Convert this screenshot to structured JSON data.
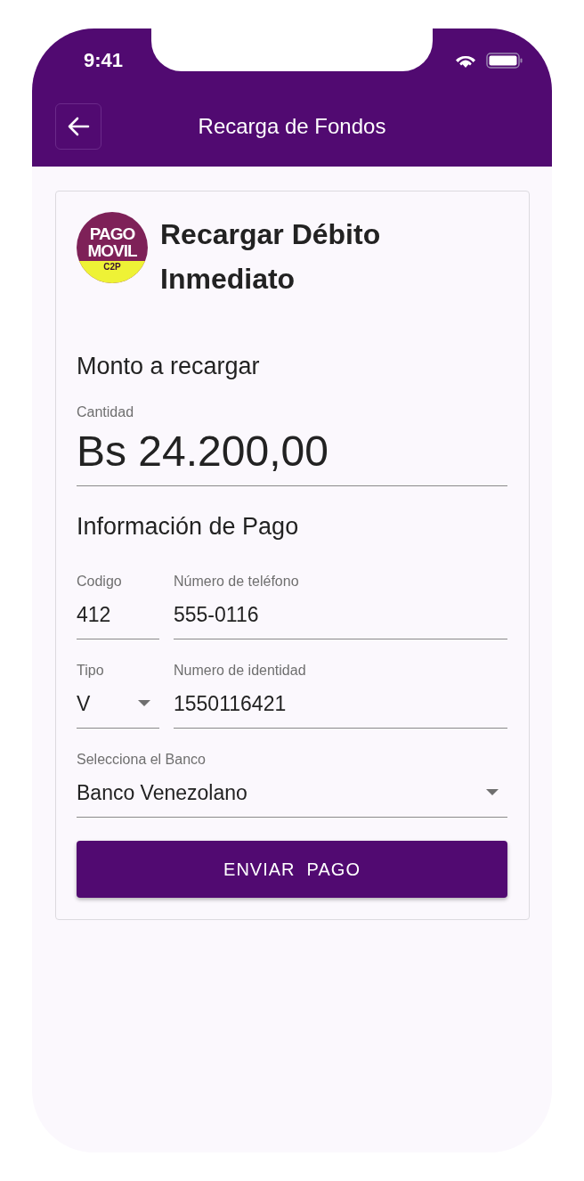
{
  "status_bar": {
    "time": "9:41"
  },
  "header": {
    "title": "Recarga de Fondos"
  },
  "card": {
    "logo": {
      "lines": [
        "PAGO",
        "MOVIL",
        "C2P"
      ]
    },
    "title": "Recargar Débito Inmediato",
    "amount_section": {
      "heading": "Monto a recargar",
      "label": "Cantidad",
      "value": "Bs 24.200,00"
    },
    "payment_section": {
      "heading": "Información de Pago",
      "rows": [
        {
          "fields": [
            {
              "kind": "text",
              "label": "Codigo",
              "value": "412"
            },
            {
              "kind": "text",
              "label": "Número de teléfono",
              "value": "555-0116"
            }
          ]
        },
        {
          "fields": [
            {
              "kind": "select",
              "label": "Tipo",
              "value": "V"
            },
            {
              "kind": "text",
              "label": "Numero de identidad",
              "value": "1550116421"
            }
          ]
        },
        {
          "fields": [
            {
              "kind": "select",
              "label": "Selecciona el Banco",
              "value": "Banco Venezolano"
            }
          ]
        }
      ]
    },
    "submit_button": "ENVIAR  PAGO"
  }
}
